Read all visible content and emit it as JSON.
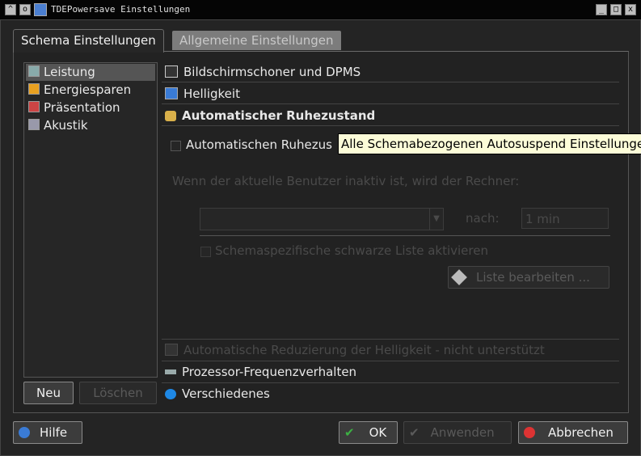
{
  "window": {
    "title": "TDEPowersave Einstellungen",
    "buttons": [
      "^",
      "o",
      "_",
      "□",
      "x"
    ]
  },
  "tabs": [
    {
      "label": "Schema Einstellungen",
      "active": true
    },
    {
      "label": "Allgemeine Einstellungen",
      "active": false
    }
  ],
  "schemes": [
    {
      "label": "Leistung",
      "icon": "performance-icon",
      "selected": true
    },
    {
      "label": "Energiesparen",
      "icon": "battery-icon",
      "selected": false
    },
    {
      "label": "Präsentation",
      "icon": "presentation-icon",
      "selected": false
    },
    {
      "label": "Akustik",
      "icon": "acoustic-icon",
      "selected": false
    }
  ],
  "scheme_buttons": {
    "new": "Neu",
    "delete": "Löschen"
  },
  "sections": [
    {
      "label": "Bildschirmschoner und DPMS",
      "icon": "screensaver-icon"
    },
    {
      "label": "Helligkeit",
      "icon": "monitor-icon"
    },
    {
      "label": "Automatischer Ruhezustand",
      "icon": "autosuspend-icon"
    },
    {
      "label": "Automatische Reduzierung der Helligkeit - nicht unterstützt",
      "icon": "dim-icon"
    },
    {
      "label": "Prozessor-Frequenzverhalten",
      "icon": "cpu-icon"
    },
    {
      "label": "Verschiedenes",
      "icon": "misc-icon"
    }
  ],
  "autosuspend": {
    "enable_label": "Automatischen Ruhezus",
    "inactive_label": "Wenn der aktuelle Benutzer inaktiv ist, wird der Rechner:",
    "after_label": "nach:",
    "after_value": "1 min",
    "blacklist_label": "Schemaspezifische schwarze Liste aktivieren",
    "edit_list_button": "Liste bearbeiten ..."
  },
  "tooltip": "Alle Schemabezogenen Autosuspend Einstellungen",
  "footer": {
    "help": "Hilfe",
    "ok": "OK",
    "apply": "Anwenden",
    "cancel": "Abbrechen"
  },
  "colors": {
    "tooltip_bg": "#fcfcd8",
    "selection": "#555555",
    "cancel_icon": "#d33"
  }
}
